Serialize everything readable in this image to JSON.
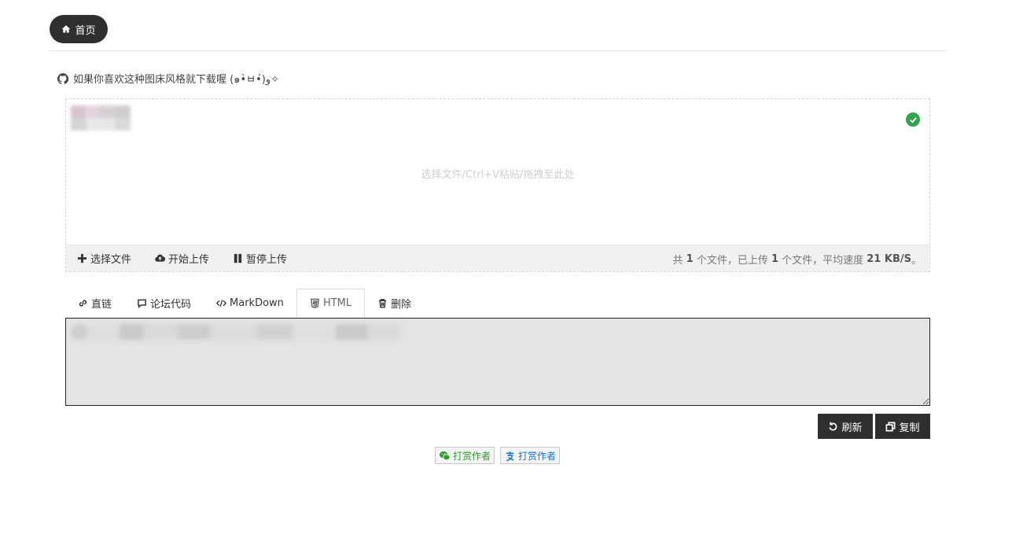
{
  "nav": {
    "home_label": "首页",
    "home_icon": "home-icon"
  },
  "promo": {
    "icon": "github-icon",
    "text": "如果你喜欢这种图床风格就下载喔 (๑•̀ㅂ•́)و✧"
  },
  "upload": {
    "drop_hint": "选择文件/Ctrl+V粘贴/拖拽至此处",
    "status_icon": "check-circle-icon",
    "status_color": "#2fa54b",
    "toolbar": {
      "select_label": "选择文件",
      "start_label": "开始上传",
      "pause_label": "暂停上传"
    },
    "stats": {
      "prefix": "共 ",
      "total": "1",
      "mid": " 个文件，已上传 ",
      "uploaded": "1",
      "mid2": " 个文件，平均速度 ",
      "speed": "21 KB/S",
      "suffix": "。"
    }
  },
  "tabs": [
    {
      "label": "直链",
      "icon": "link-icon"
    },
    {
      "label": "论坛代码",
      "icon": "comment-icon"
    },
    {
      "label": "MarkDown",
      "icon": "code-icon"
    },
    {
      "label": "HTML",
      "icon": "html5-icon",
      "active": true
    },
    {
      "label": "删除",
      "icon": "trash-icon"
    }
  ],
  "actions": {
    "refresh_label": "刷新",
    "copy_label": "复制"
  },
  "donate": {
    "wechat_label": "打赏作者",
    "wechat_color": "#2a9d2a",
    "alipay_label": "打赏作者",
    "alipay_color": "#1a73c8"
  }
}
